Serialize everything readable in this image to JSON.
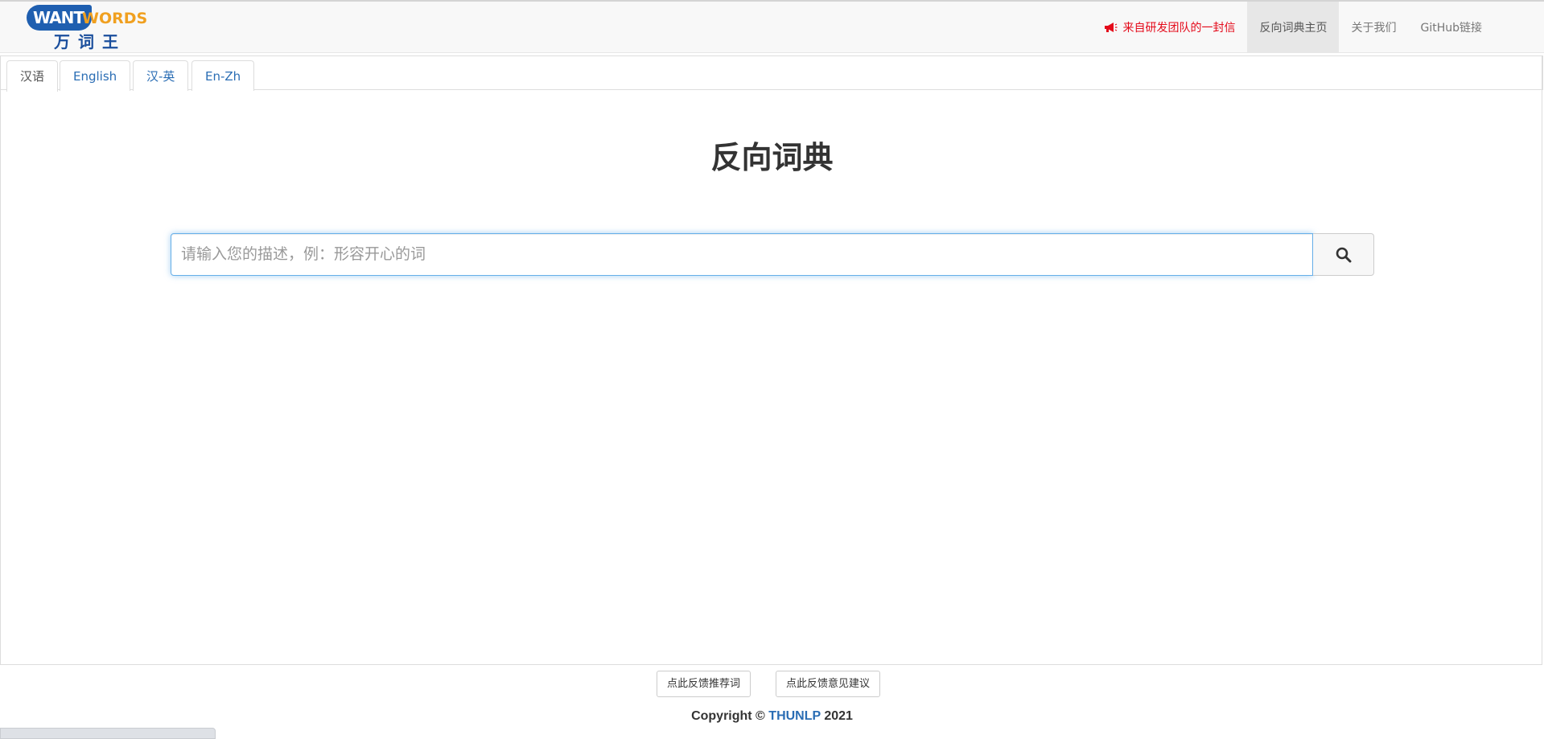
{
  "logo": {
    "badge": "WANT",
    "words": "WORDS",
    "cn": "万词王"
  },
  "nav": {
    "notice": "来自研发团队的一封信",
    "home": "反向词典主页",
    "about": "关于我们",
    "github": "GitHub链接"
  },
  "tabs": [
    {
      "label": "汉语",
      "active": true
    },
    {
      "label": "English",
      "active": false
    },
    {
      "label": "汉-英",
      "active": false
    },
    {
      "label": "En-Zh",
      "active": false
    }
  ],
  "main": {
    "title": "反向词典",
    "search_placeholder": "请输入您的描述，例：形容开心的词"
  },
  "feedback": {
    "recommend": "点此反馈推荐词",
    "suggest": "点此反馈意见建议"
  },
  "footer": {
    "prefix": "Copyright ©",
    "org": "THUNLP",
    "year": "2021"
  },
  "colors": {
    "accent": "#2a6db4",
    "notice": "#e40a1a",
    "logo_blue": "#1f5fb0",
    "logo_orange": "#f0a020"
  },
  "icons": {
    "notice": "megaphone-icon",
    "search": "search-icon"
  }
}
